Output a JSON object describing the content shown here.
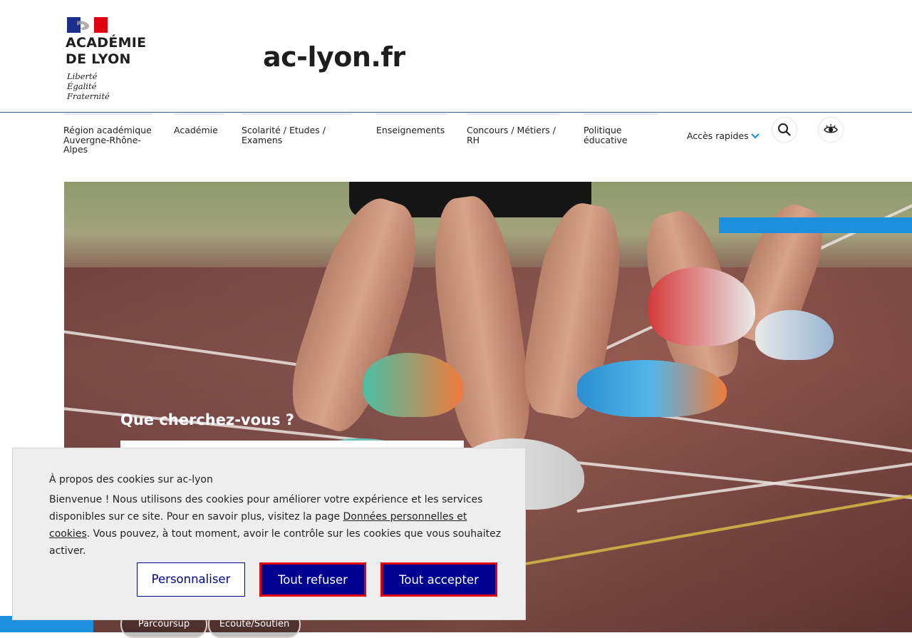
{
  "header": {
    "logo": {
      "line1": "ACADÉMIE",
      "line2": "DE LYON",
      "motto": [
        "Liberté",
        "Égalité",
        "Fraternité"
      ]
    },
    "site_title": "ac-lyon.fr"
  },
  "nav": {
    "items": [
      {
        "label": "Région académique Auvergne-Rhône-Alpes"
      },
      {
        "label": "Académie"
      },
      {
        "label": "Scolarité / Etudes / Examens"
      },
      {
        "label": "Enseignements"
      },
      {
        "label": "Concours / Métiers / RH"
      },
      {
        "label": "Politique éducative"
      }
    ],
    "quick_access": "Accès rapides",
    "icons": [
      "chevron-down-icon",
      "search-icon",
      "eye-icon"
    ]
  },
  "hero": {
    "question": "Que cherchez-vous ?",
    "search_value": "",
    "chips": [
      "Parcoursup",
      "Ecoute/Soutien"
    ]
  },
  "cookie": {
    "title": "À propos des cookies sur ac-lyon",
    "text_before_link": "Bienvenue ! Nous utilisons des cookies pour améliorer votre expérience et les services disponibles sur ce site. Pour en savoir plus, visitez la page ",
    "link": "Données personnelles et cookies",
    "text_after_link": ". Vous pouvez, à tout moment, avoir le contrôle sur les cookies que vous souhaitez activer.",
    "buttons": {
      "customize": "Personnaliser",
      "refuse": "Tout refuser",
      "accept": "Tout accepter"
    }
  },
  "colors": {
    "navy": "#000091",
    "red": "#e1000f",
    "accent_blue": "#1e8fdc"
  }
}
